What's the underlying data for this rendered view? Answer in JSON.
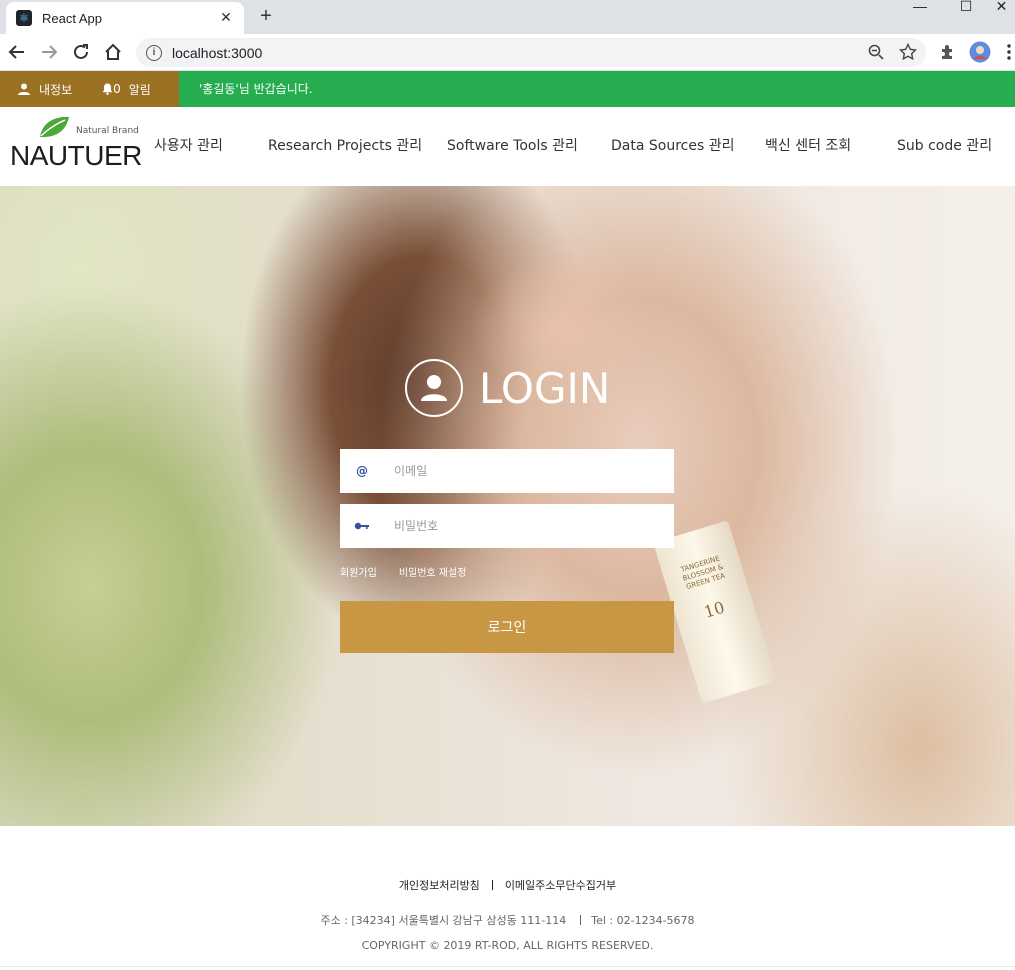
{
  "browser": {
    "tab_title": "React App",
    "tab_close": "✕",
    "new_tab": "+",
    "url": "localhost:3000",
    "info_glyph": "i",
    "window_controls": {
      "minimize": "—",
      "maximize": "☐",
      "close": "✕"
    }
  },
  "topbar": {
    "my_info": "내정보",
    "alert_count": "0",
    "alert_label": "알림",
    "welcome": "'홍길동'님 반갑습니다.",
    "colors": {
      "bar": "#25ad50",
      "left": "#9b7124"
    }
  },
  "header": {
    "logo_brand": "Natural Brand",
    "logo_name": "NAUTUER",
    "nav": [
      "사용자 관리",
      "Research Projects 관리",
      "Software Tools 관리",
      "Data Sources 관리",
      "백신 센터 조회",
      "Sub code 관리"
    ]
  },
  "hero": {
    "bottle_label": "TANGERINE BLOSSOM & GREEN TEA",
    "bottle_number": "10"
  },
  "login": {
    "title": "LOGIN",
    "email_icon": "@",
    "email_placeholder": "이메일",
    "password_placeholder": "비밀번호",
    "signup_link": "회원가입",
    "reset_link": "비밀번호 재설정",
    "submit": "로그인",
    "button_color": "#c79744"
  },
  "footer": {
    "privacy": "개인정보처리방침",
    "no_email": "이메일주소무단수집거부",
    "address": "주소 : [34234] 서울특별시 강남구 삼성동 111-114",
    "tel": "Tel : 02-1234-5678",
    "copyright": "COPYRIGHT © 2019 RT-ROD, ALL RIGHTS RESERVED."
  }
}
